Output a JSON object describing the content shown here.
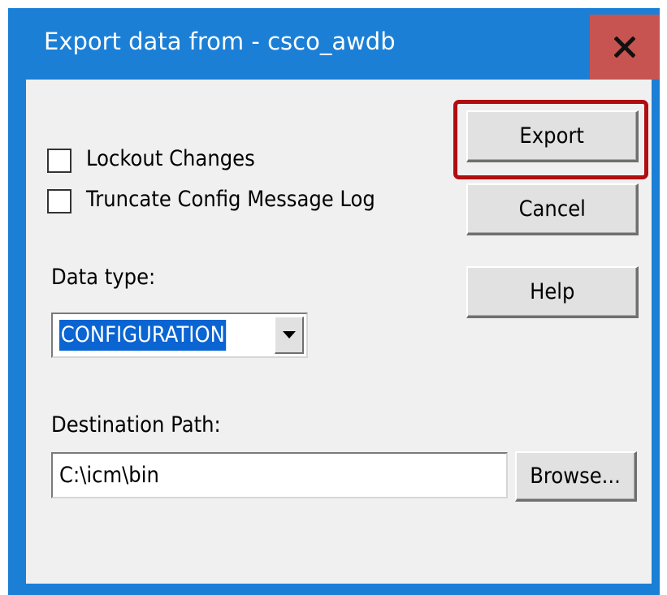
{
  "window": {
    "title": "Export data from - csco_awdb",
    "close_label": "x",
    "accent_color": "#1b7fd6",
    "close_color": "#c75450"
  },
  "options": {
    "lockout_changes": {
      "label": "Lockout Changes",
      "checked": false
    },
    "truncate_log": {
      "label": "Truncate Config Message Log",
      "checked": false
    }
  },
  "data_type": {
    "label": "Data type:",
    "selected": "CONFIGURATION"
  },
  "destination": {
    "label": "Destination Path:",
    "value": "C:\\icm\\bin"
  },
  "buttons": {
    "export": "Export",
    "cancel": "Cancel",
    "help": "Help",
    "browse": "Browse..."
  },
  "annotation": {
    "highlight_color": "#b00d10",
    "highlight_target": "export-button"
  }
}
